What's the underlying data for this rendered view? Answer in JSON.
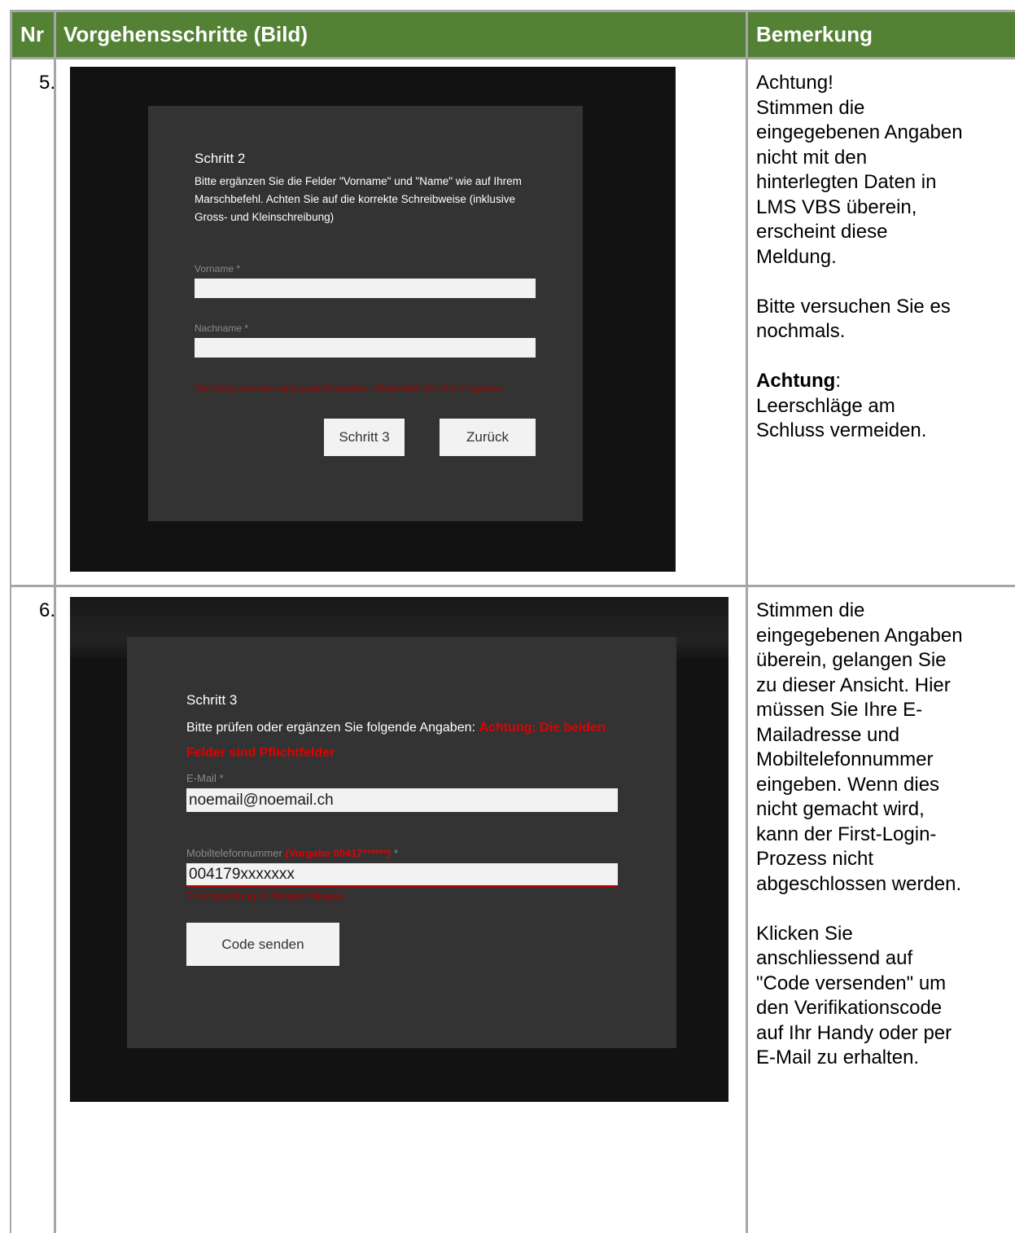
{
  "header": {
    "nr": "Nr",
    "steps": "Vorgehensschritte (Bild)",
    "remark": "Bemerkung"
  },
  "rows": [
    {
      "number": "5.",
      "screenshot": {
        "title": "Schritt 2",
        "description": "Bitte ergänzen Sie die Felder \"Vorname\" und \"Name\" wie auf Ihrem Marschbefehl. Achten Sie auf die korrekte Schreibweise (inklusive Gross- und Kleinschreibung)",
        "field_firstname_label": "Vorname *",
        "field_firstname_value": "",
        "field_lastname_label": "Nachname *",
        "field_lastname_value": "",
        "error": "Die Daten konnten nicht geprüft werden. Überprüfen Sie Ihre Eingaben.",
        "next_button": "Schritt 3",
        "back_button": "Zurück"
      },
      "remark": {
        "lines": [
          "Achtung!",
          "Stimmen die",
          "eingegebenen Angaben",
          "nicht mit den",
          "hinterlegten Daten in",
          "LMS VBS überein,",
          "erscheint diese",
          "Meldung."
        ],
        "retry_lines": [
          "Bitte versuchen Sie es",
          "nochmals."
        ],
        "note_label": "Achtung",
        "note_colon": ":",
        "note_lines": [
          "Leerschläge am",
          "Schluss vermeiden."
        ]
      }
    },
    {
      "number": "6.",
      "screenshot": {
        "title": "Schritt 3",
        "description_prefix": "Bitte prüfen oder ergänzen Sie folgende Angaben: ",
        "description_warning": "Achtung: Die beiden Felder sind Pflichtfelder",
        "email_label": "E-Mail *",
        "email_value": "noemail@noemail.ch",
        "phone_label": "Mobiltelefonnummer ",
        "phone_hint": "(Vorgabe 00417******)",
        "phone_required": " *",
        "phone_value": "004179xxxxxxx",
        "phone_error": "Formatprüfung ist fehlgeschlagen",
        "send_button": "Code senden"
      },
      "remark": {
        "lines": [
          "Stimmen die",
          "eingegebenen Angaben",
          "überein, gelangen Sie",
          "zu dieser Ansicht. Hier",
          "müssen Sie Ihre E-",
          "Mailadresse und",
          "Mobiltelefonnummer",
          "eingeben. Wenn dies",
          "nicht gemacht wird,",
          "kann der First-Login-",
          "Prozess nicht",
          "abgeschlossen werden."
        ],
        "click_lines": [
          "Klicken Sie",
          "anschliessend auf",
          "\"Code versenden\" um",
          "den Verifikationscode",
          "auf Ihr Handy oder per",
          "E-Mail zu erhalten."
        ]
      }
    }
  ]
}
